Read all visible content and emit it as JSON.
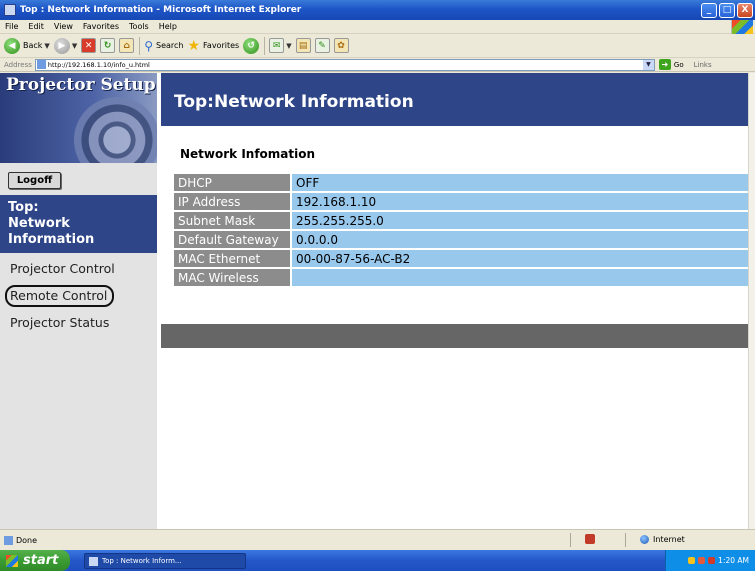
{
  "window": {
    "title": "Top : Network Information - Microsoft Internet Explorer",
    "buttons": {
      "minimize": "_",
      "maximize": "□",
      "close": "X"
    }
  },
  "menu": [
    "File",
    "Edit",
    "View",
    "Favorites",
    "Tools",
    "Help"
  ],
  "toolbar": {
    "back_label": "Back",
    "search_label": "Search",
    "favorites_label": "Favorites"
  },
  "address": {
    "label": "Address",
    "url": "http://192.168.1.10/info_u.html",
    "go_label": "Go",
    "links_label": "Links"
  },
  "sidebar": {
    "brand": "Projector Setup",
    "logoff_label": "Logoff",
    "active_item": [
      "Top:",
      "Network",
      "Information"
    ],
    "items": [
      "Projector Control",
      "Remote Control",
      "Projector Status"
    ]
  },
  "main": {
    "header": "Top:Network Information",
    "section_title": "Network Infomation",
    "rows": [
      {
        "key": "DHCP",
        "value": "OFF"
      },
      {
        "key": "IP Address",
        "value": "192.168.1.10"
      },
      {
        "key": "Subnet Mask",
        "value": "255.255.255.0"
      },
      {
        "key": "Default Gateway",
        "value": "0.0.0.0"
      },
      {
        "key": "MAC Ethernet",
        "value": "00-00-87-56-AC-B2"
      },
      {
        "key": "MAC Wireless",
        "value": ""
      }
    ]
  },
  "status": {
    "text": "Done",
    "zone": "Internet"
  },
  "taskbar": {
    "start_label": "start",
    "task_item": "Top : Network Inform...",
    "clock": "1:20 AM"
  },
  "colors": {
    "nav_blue": "#2e4588",
    "key_cell": "#8c8c8c",
    "value_cell": "#99c8ed"
  }
}
